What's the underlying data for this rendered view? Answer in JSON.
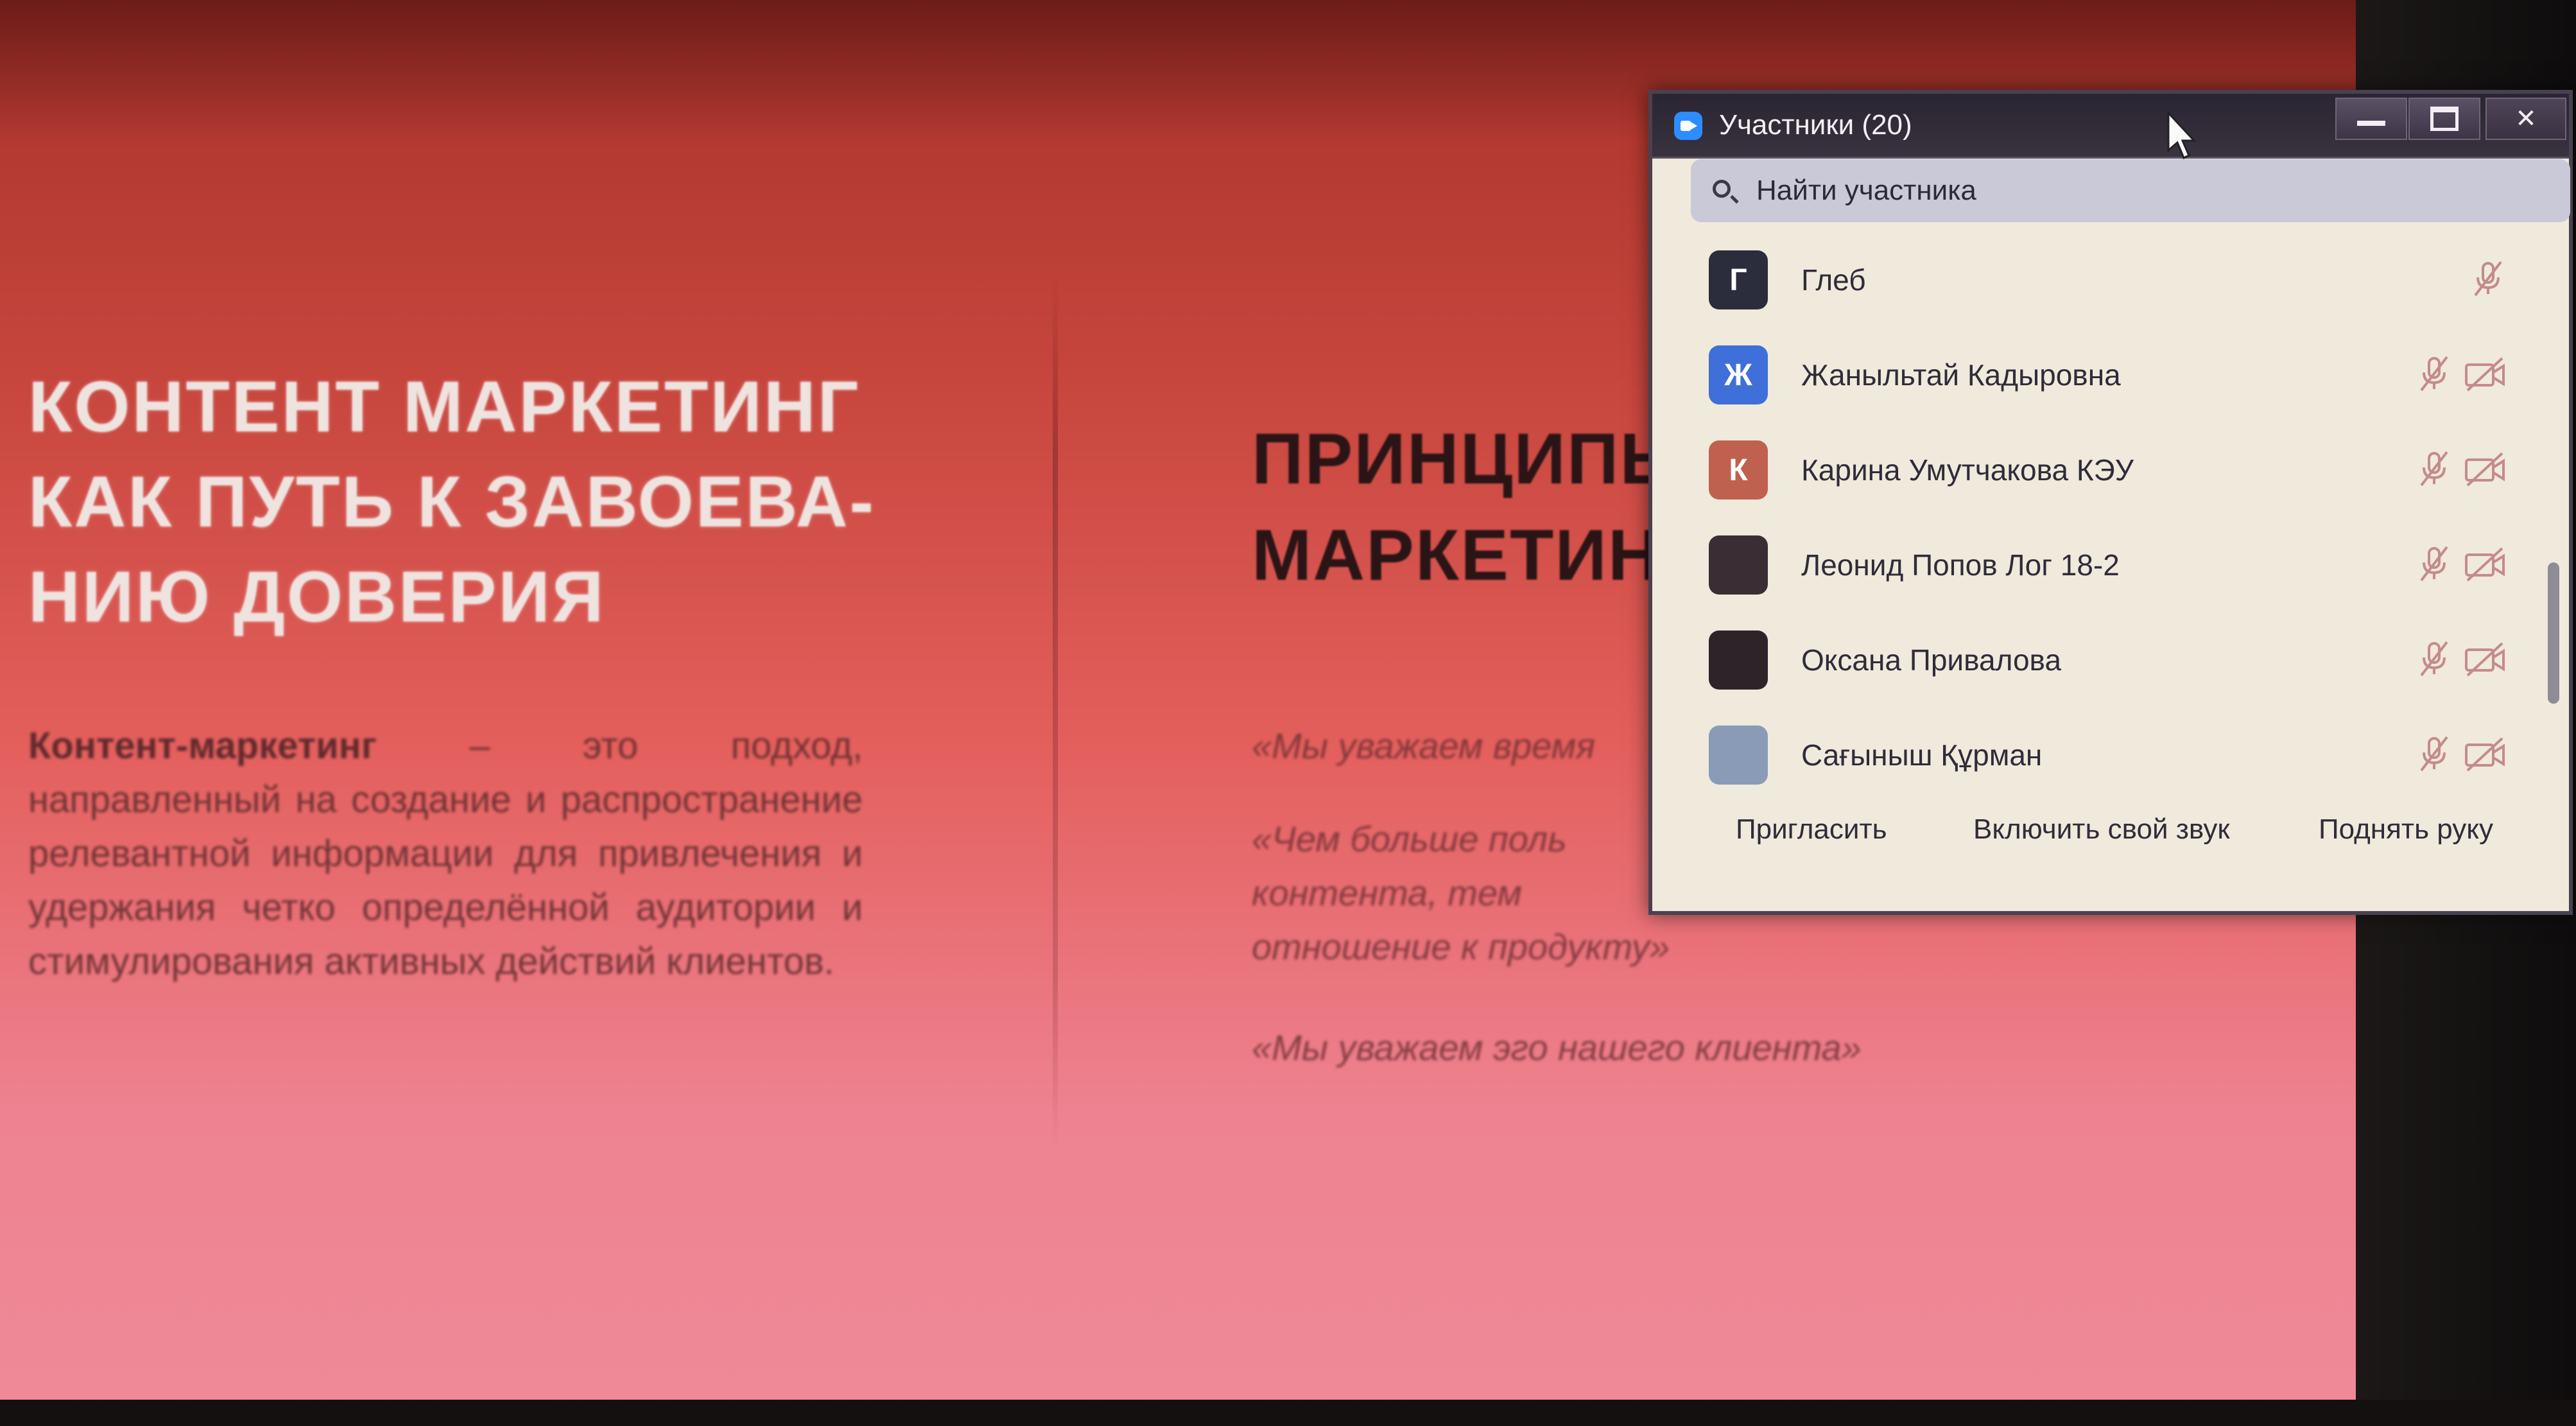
{
  "slide": {
    "left_title": "КОНТЕНТ   МАРКЕТИНГ\nКАК ПУТЬ К ЗАВОЕВА-\nНИЮ ДОВЕРИЯ",
    "left_body_bold": "Контент-маркетинг",
    "left_body_rest": " – это подход, направленный на создание и распространение релевантной информации для привлечения и удержания четко определённой аудитории и стимулирования активных действий клиентов.",
    "right_title": "ПРИНЦИПЫ\nМАРКЕТИНГ",
    "quote1": "«Мы уважаем время",
    "quote2": "«Чем больше поль\nконтента, тем\nотношение к продукту»",
    "quote3": "«Мы уважаем эго нашего клиента»"
  },
  "panel": {
    "title": "Участники (20)",
    "app_icon": "zoom-camera-icon",
    "search_placeholder": "Найти участника",
    "participants": [
      {
        "initial": "Г",
        "name": "Глеб",
        "color": "#2b2d3d",
        "mic_muted": true,
        "cam_off": false
      },
      {
        "initial": "Ж",
        "name": "Жаныльтай Кадыровна",
        "color": "#3f6fd8",
        "mic_muted": true,
        "cam_off": true
      },
      {
        "initial": "К",
        "name": "Карина Умутчакова КЭУ",
        "color": "#c0614f",
        "mic_muted": true,
        "cam_off": true
      },
      {
        "initial": "",
        "name": "Леонид Попов Лог 18-2",
        "color": "#3a2e34",
        "mic_muted": true,
        "cam_off": true
      },
      {
        "initial": "",
        "name": "Оксана Привалова",
        "color": "#2c2428",
        "mic_muted": true,
        "cam_off": true
      },
      {
        "initial": "",
        "name": "Сағыныш Құрман",
        "color": "#8a9bb8",
        "mic_muted": true,
        "cam_off": true
      }
    ],
    "footer": {
      "invite": "Пригласить",
      "unmute": "Включить свой звук",
      "raise_hand": "Поднять руку"
    },
    "colors": {
      "panel_bg": "#efeadb",
      "titlebar": "#2a2532",
      "muted_icon": "#c58a8c"
    }
  }
}
